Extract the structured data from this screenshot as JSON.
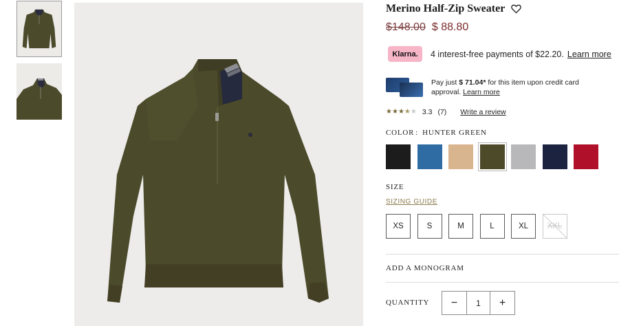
{
  "product": {
    "title": "Merino Half-Zip Sweater",
    "old_price": "$148.00",
    "new_price": "$ 88.80"
  },
  "klarna": {
    "badge": "Klarna.",
    "text": "4 interest-free payments of $22.20.",
    "link": "Learn more"
  },
  "credit": {
    "prefix": "Pay just ",
    "amount": "$ 71.04*",
    "suffix": " for this item upon credit card approval.",
    "link": "Learn more"
  },
  "rating": {
    "value": "3.3",
    "count": "(7)",
    "stars": 3.3,
    "write_review": "Write a review"
  },
  "color": {
    "label": "COLOR",
    "selected": "HUNTER GREEN",
    "swatches": [
      {
        "name": "black",
        "hex": "#1c1c1c"
      },
      {
        "name": "blue",
        "hex": "#2f6ca3"
      },
      {
        "name": "camel",
        "hex": "#d8b58e"
      },
      {
        "name": "hunter-green",
        "hex": "#4d4a2a"
      },
      {
        "name": "grey",
        "hex": "#b8b8ba"
      },
      {
        "name": "navy",
        "hex": "#1c2340"
      },
      {
        "name": "red",
        "hex": "#b0102a"
      }
    ]
  },
  "size": {
    "label": "SIZE",
    "guide": "SIZING GUIDE",
    "options": [
      "XS",
      "S",
      "M",
      "L",
      "XL",
      "XXL"
    ],
    "unavailable": [
      "XXL"
    ]
  },
  "monogram": "ADD A MONOGRAM",
  "quantity": {
    "label": "QUANTITY",
    "value": "1",
    "minus": "−",
    "plus": "+"
  },
  "colors": {
    "sweater": "#4b4a2b",
    "price_red": "#7a2a2a",
    "klarna_pink": "#f6b6c8",
    "sizing_guide": "#8a7a4c"
  }
}
